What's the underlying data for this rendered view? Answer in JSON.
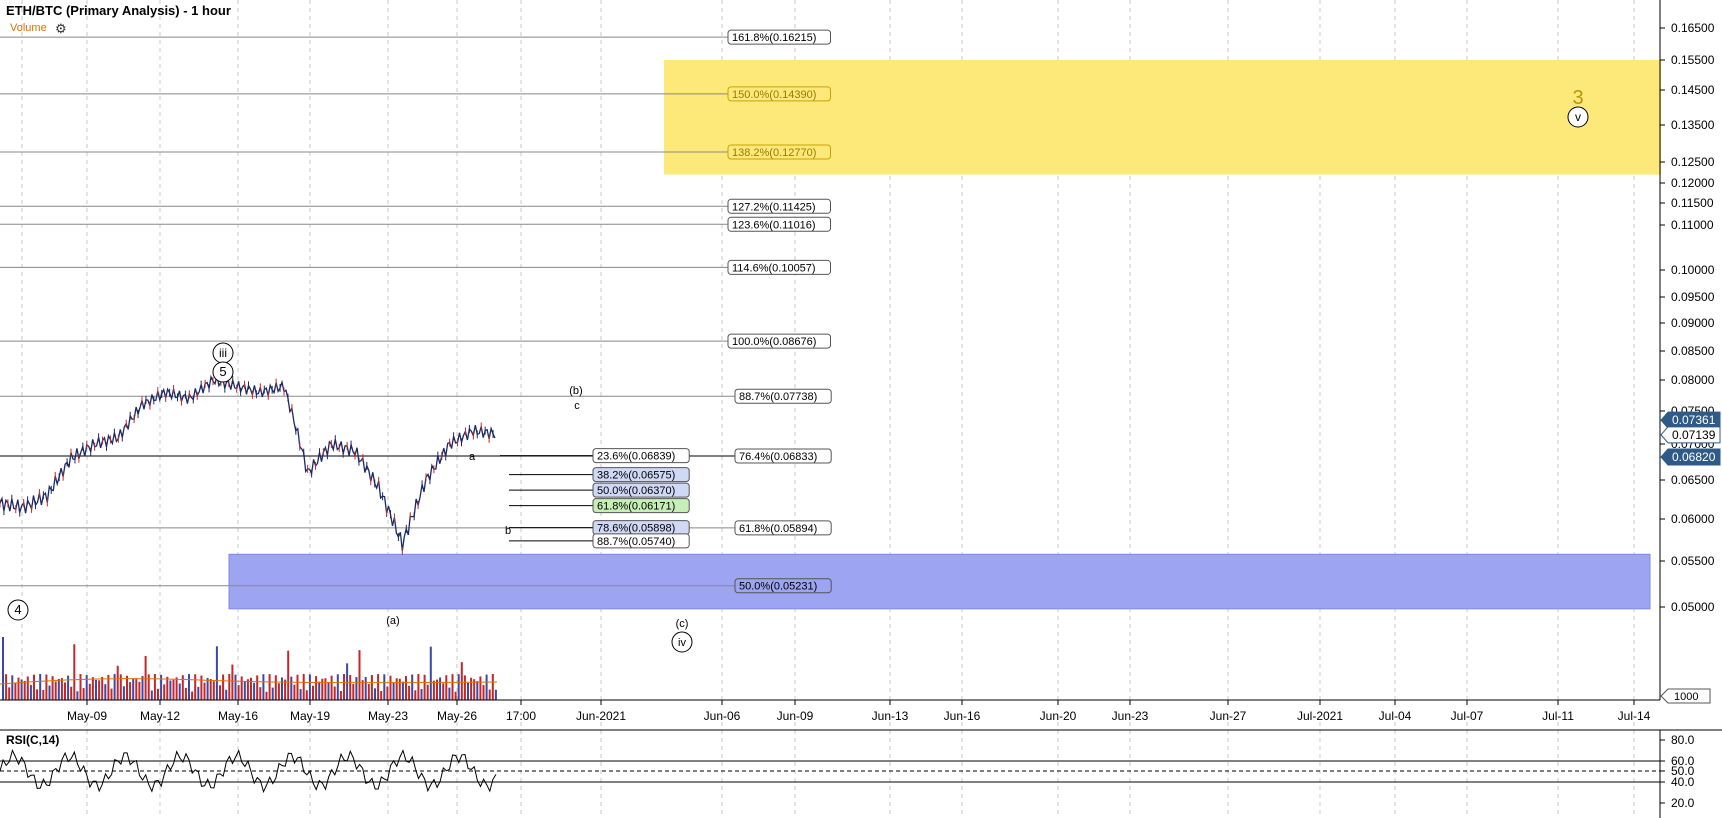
{
  "header": {
    "title": "ETH/BTC (Primary Analysis) - 1 hour",
    "volume_label": "Volume",
    "settings_icon": "gear-icon"
  },
  "rsi_panel": {
    "title": "RSI(C,14)"
  },
  "chart_data": {
    "type": "candlestick",
    "title": "ETH/BTC (Primary Analysis) - 1 hour",
    "y_ticks": [
      "0.16500",
      "0.15500",
      "0.14500",
      "0.13500",
      "0.12500",
      "0.12000",
      "0.11500",
      "0.11000",
      "0.10000",
      "0.09500",
      "0.09000",
      "0.08500",
      "0.08000",
      "0.07500",
      "0.07000",
      "0.06500",
      "0.06000",
      "0.05500",
      "0.05000"
    ],
    "price_tags": [
      {
        "text": "0.07361",
        "value": 0.07361,
        "color": "#2e5a88"
      },
      {
        "text": "0.07139",
        "value": 0.07139,
        "color": "#ffffff"
      },
      {
        "text": "0.06820",
        "value": 0.0682,
        "color": "#2e5a88"
      }
    ],
    "x_ticks": [
      "May-09",
      "May-12",
      "May-16",
      "May-19",
      "May-23",
      "May-26",
      "17:00",
      "Jun-2021",
      "Jun-06",
      "Jun-09",
      "Jun-13",
      "Jun-16",
      "Jun-20",
      "Jun-23",
      "Jun-27",
      "Jul-2021",
      "Jul-04",
      "Jul-07",
      "Jul-11",
      "Jul-14"
    ],
    "volume_axis_label": "1000",
    "price_series": [
      {
        "date": "May-06",
        "close": 0.062
      },
      {
        "date": "May-07",
        "close": 0.0615
      },
      {
        "date": "May-08",
        "close": 0.063
      },
      {
        "date": "May-09",
        "close": 0.068
      },
      {
        "date": "May-10",
        "close": 0.07
      },
      {
        "date": "May-11",
        "close": 0.071
      },
      {
        "date": "May-12",
        "close": 0.076
      },
      {
        "date": "May-13",
        "close": 0.078
      },
      {
        "date": "May-14",
        "close": 0.077
      },
      {
        "date": "May-15",
        "close": 0.08
      },
      {
        "date": "May-16",
        "close": 0.079
      },
      {
        "date": "May-17",
        "close": 0.078
      },
      {
        "date": "May-18",
        "close": 0.079
      },
      {
        "date": "May-19",
        "close": 0.066
      },
      {
        "date": "May-20",
        "close": 0.07
      },
      {
        "date": "May-21",
        "close": 0.069
      },
      {
        "date": "May-22",
        "close": 0.064
      },
      {
        "date": "May-23",
        "close": 0.057
      },
      {
        "date": "May-24",
        "close": 0.065
      },
      {
        "date": "May-25",
        "close": 0.07
      },
      {
        "date": "May-26",
        "close": 0.072
      },
      {
        "date": "May-27",
        "close": 0.0715
      }
    ],
    "fib_levels_right": [
      {
        "text": "161.8%(0.16215)",
        "value": 0.16215
      },
      {
        "text": "150.0%(0.14390)",
        "value": 0.1439
      },
      {
        "text": "138.2%(0.12770)",
        "value": 0.1277
      },
      {
        "text": "127.2%(0.11425)",
        "value": 0.11425
      },
      {
        "text": "123.6%(0.11016)",
        "value": 0.11016
      },
      {
        "text": "114.6%(0.10057)",
        "value": 0.10057
      },
      {
        "text": "100.0%(0.08676)",
        "value": 0.08676
      },
      {
        "text": "88.7%(0.07738)",
        "value": 0.07738
      },
      {
        "text": "76.4%(0.06833)",
        "value": 0.06833
      },
      {
        "text": "61.8%(0.05894)",
        "value": 0.05894
      },
      {
        "text": "50.0%(0.05231)",
        "value": 0.05231
      }
    ],
    "fib_levels_retrace": [
      {
        "text": "23.6%(0.06839)",
        "value": 0.06839,
        "fill": "#ffffff"
      },
      {
        "text": "38.2%(0.06575)",
        "value": 0.06575,
        "fill": "#cfd8f4"
      },
      {
        "text": "50.0%(0.06370)",
        "value": 0.0637,
        "fill": "#cfd8f4"
      },
      {
        "text": "61.8%(0.06171)",
        "value": 0.06171,
        "fill": "#c6efb8"
      },
      {
        "text": "78.6%(0.05898)",
        "value": 0.05898,
        "fill": "#cfd8f4"
      },
      {
        "text": "88.7%(0.05740)",
        "value": 0.0574,
        "fill": "#ffffff"
      }
    ],
    "zones": [
      {
        "name": "target-zone",
        "from": 0.122,
        "to": 0.155,
        "color": "#fde87a"
      },
      {
        "name": "support-zone",
        "from": 0.0498,
        "to": 0.0558,
        "color": "#9da4f2"
      }
    ],
    "wave_labels": [
      "iii",
      "5",
      "4",
      "(a)",
      "(b)",
      "c",
      "a",
      "b",
      "(c)",
      "iv",
      "3",
      "v"
    ],
    "rsi": {
      "y_ticks": [
        "80.0",
        "60.0",
        "50.0",
        "40.0",
        "20.0"
      ],
      "lines": [
        60,
        50,
        40
      ],
      "last": 51
    }
  }
}
